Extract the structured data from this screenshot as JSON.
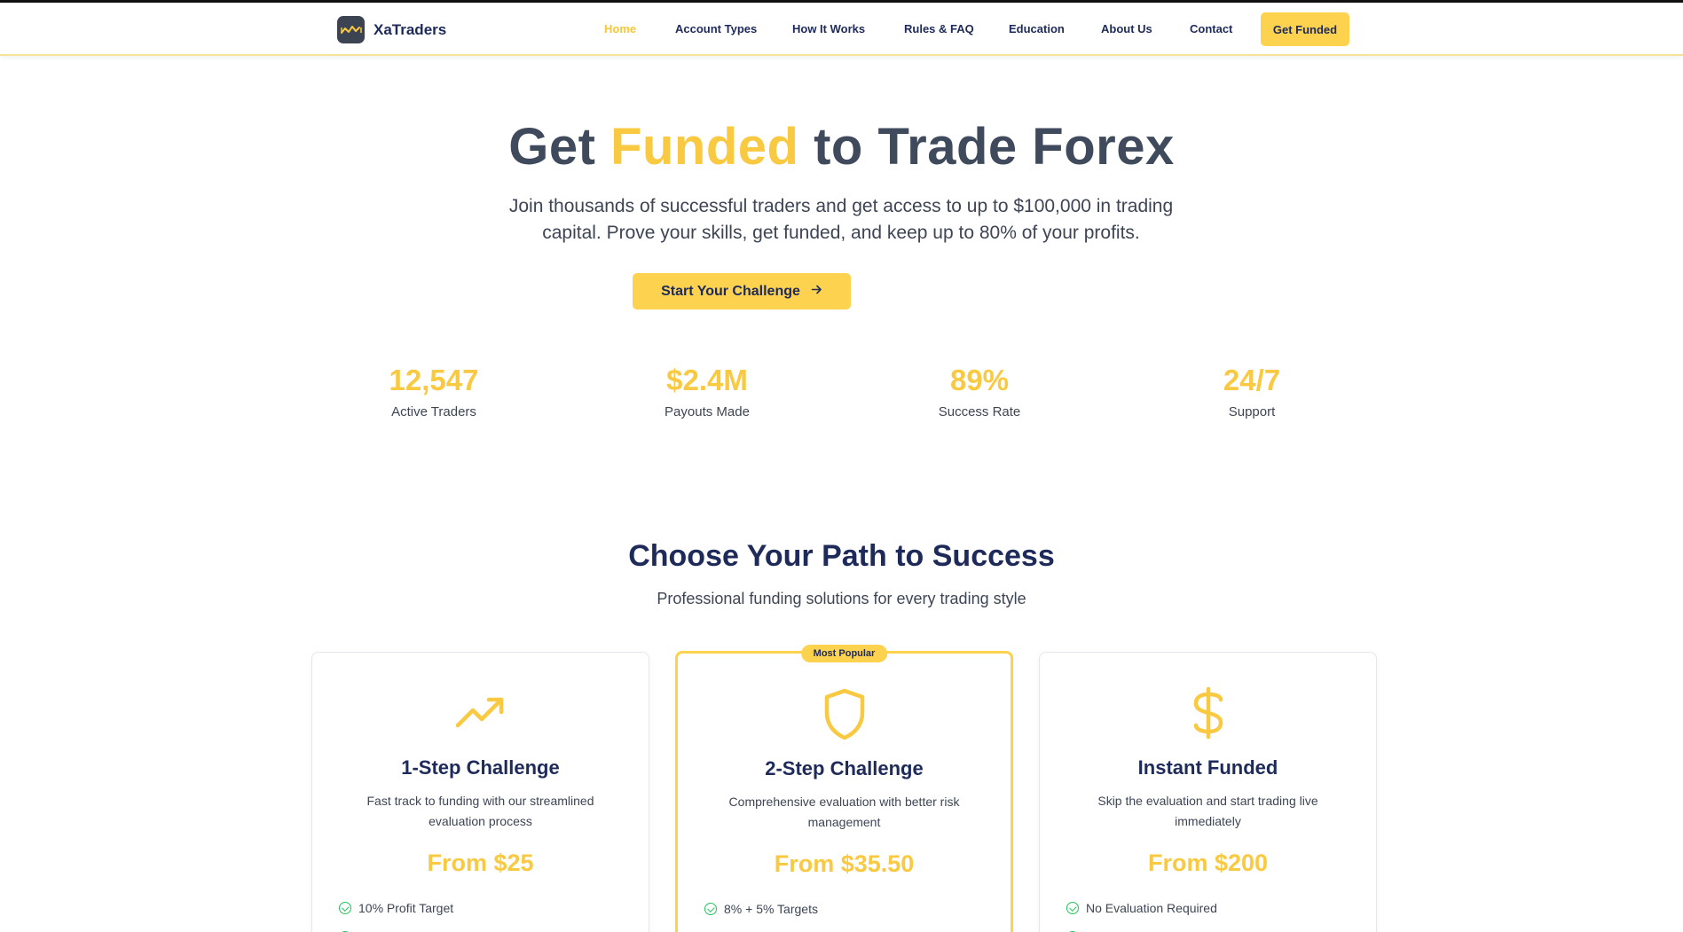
{
  "brand": {
    "name": "XaTraders",
    "logo_icon": "chart-logo-icon"
  },
  "nav": {
    "items": [
      {
        "label": "Home",
        "active": true
      },
      {
        "label": "Account Types",
        "active": false
      },
      {
        "label": "How It Works",
        "active": false
      },
      {
        "label": "Rules & FAQ",
        "active": false
      },
      {
        "label": "Education",
        "active": false
      },
      {
        "label": "About Us",
        "active": false
      },
      {
        "label": "Contact",
        "active": false
      }
    ],
    "cta_label": "Get Funded"
  },
  "hero": {
    "title_part1": "Get",
    "title_accent": "Funded",
    "title_part2": "to Trade Forex",
    "subtitle_line1": "Join thousands of successful traders and get access to up to $100,000 in trading",
    "subtitle_line2": "capital. Prove your skills, get funded, and keep up to 80% of your profits.",
    "cta_label": "Start Your Challenge",
    "cta_icon": "arrow-right-icon"
  },
  "stats": [
    {
      "value": "12,547",
      "label": "Active Traders"
    },
    {
      "value": "$2.4M",
      "label": "Payouts Made"
    },
    {
      "value": "89%",
      "label": "Success Rate"
    },
    {
      "value": "24/7",
      "label": "Support"
    }
  ],
  "paths": {
    "title": "Choose Your Path to Success",
    "subtitle": "Professional funding solutions for every trading style",
    "cards": [
      {
        "icon": "trending-up-icon",
        "title": "1-Step Challenge",
        "desc_line1": "Fast track to funding with our streamlined",
        "desc_line2": "evaluation process",
        "price": "From $25",
        "feature": "10% Profit Target",
        "featured": false
      },
      {
        "icon": "shield-icon",
        "badge": "Most Popular",
        "title": "2-Step Challenge",
        "desc_line1": "Comprehensive evaluation with better risk",
        "desc_line2": "management",
        "price": "From $35.50",
        "feature": "8% + 5% Targets",
        "featured": true
      },
      {
        "icon": "dollar-icon",
        "title": "Instant Funded",
        "desc_line1": "Skip the evaluation and start trading live",
        "desc_line2": "immediately",
        "price": "From $200",
        "feature": "No Evaluation Required",
        "featured": false
      }
    ]
  },
  "colors": {
    "accent": "#f9c941",
    "button": "#fdd24f",
    "navy": "#1e2a5a",
    "heading_gray": "#3f4a5c",
    "check_green": "#22c55e"
  }
}
